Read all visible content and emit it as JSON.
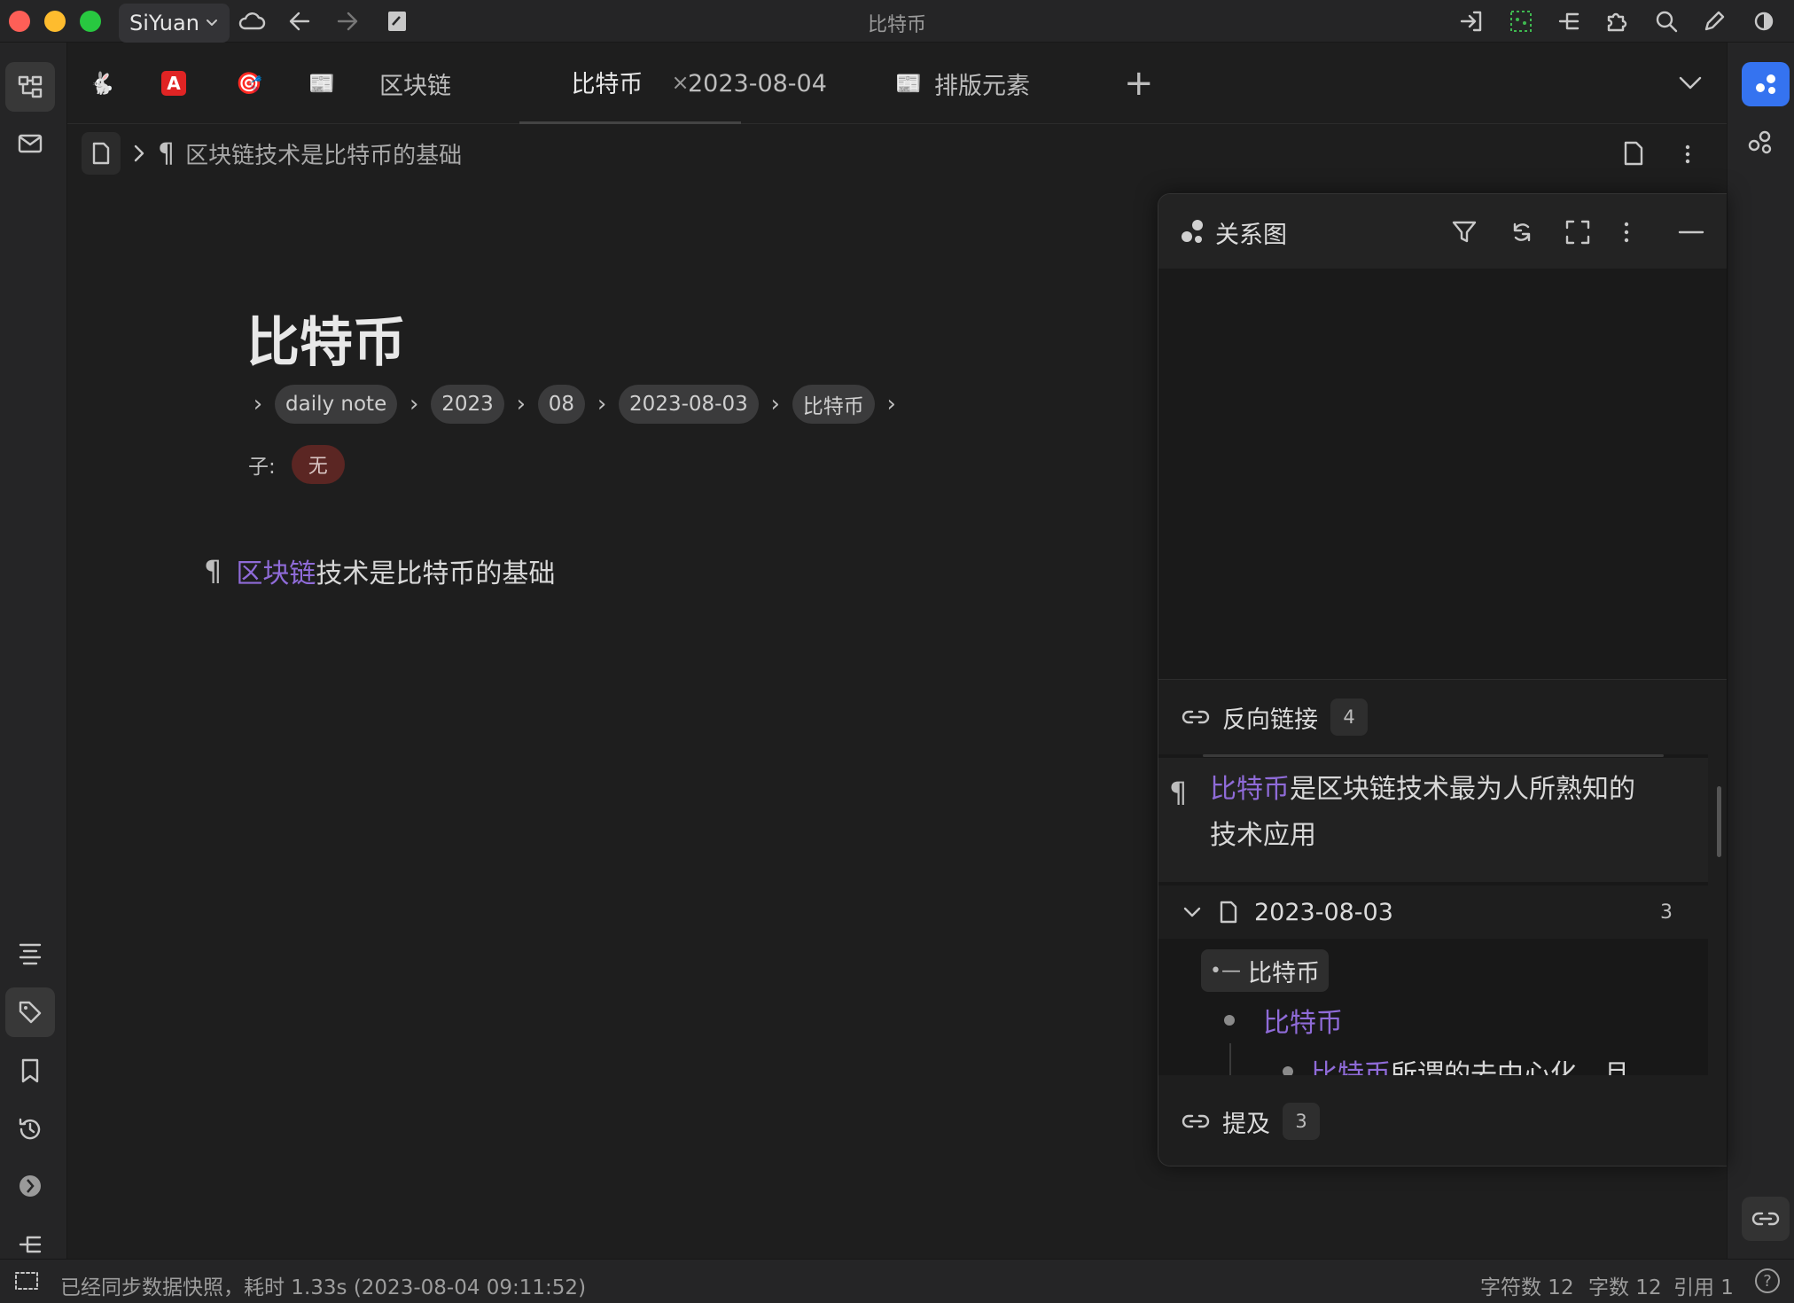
{
  "app": {
    "name": "SiYuan",
    "window_title": "比特币"
  },
  "tabs": [
    {
      "icon": "🐇",
      "label": ""
    },
    {
      "icon": "A",
      "label": ""
    },
    {
      "icon": "🎯",
      "label": ""
    },
    {
      "icon": "📰",
      "label": ""
    },
    {
      "icon": "",
      "label": "区块链"
    },
    {
      "icon": "",
      "label": "比特币",
      "active": true,
      "close": "×"
    },
    {
      "icon": "",
      "label": "2023-08-04"
    },
    {
      "icon": "📰",
      "label": "排版元素"
    }
  ],
  "tabbar": {
    "add": "+"
  },
  "breadcrumb": {
    "text": "区块链技术是比特币的基础"
  },
  "doc": {
    "title": "比特币",
    "path": [
      "daily note",
      "2023",
      "08",
      "2023-08-03",
      "比特币"
    ],
    "children_label": "子:",
    "children_value": "无",
    "paragraph": {
      "link": "区块链",
      "rest": "技术是比特币的基础"
    }
  },
  "graph_panel": {
    "title": "关系图",
    "backlinks": {
      "label": "反向链接",
      "count": "4",
      "first_block": {
        "link": "比特币",
        "rest": "是区块链技术最为人所熟知的",
        "line2": "技术应用"
      },
      "group": {
        "doc": "2023-08-03",
        "count": "3"
      },
      "heading_chip": "比特币",
      "bullet1": "比特币",
      "bullet2_link": "比特币",
      "bullet2_rest": "所谓的去中心化，且"
    },
    "mentions": {
      "label": "提及",
      "count": "3"
    }
  },
  "status": {
    "message": "已经同步数据快照，耗时 1.33s (2023-08-04 09:11:52)",
    "chars": "字符数 12",
    "words": "字数 12",
    "refs": "引用 1",
    "help": "?"
  },
  "colors": {
    "link": "#8f6bd8",
    "accent": "#3573f0",
    "red_pill": "#5b2623"
  }
}
